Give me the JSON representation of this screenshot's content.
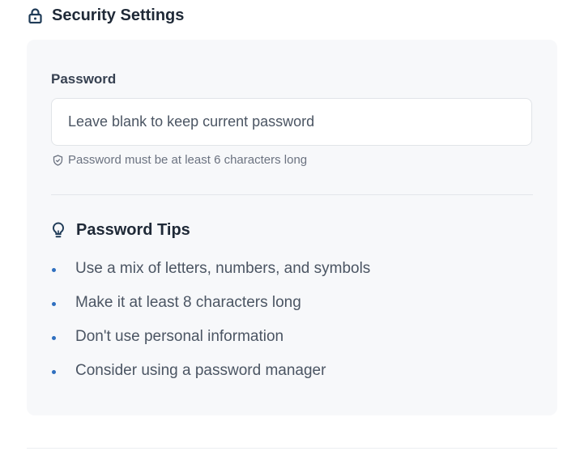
{
  "section": {
    "title": "Security Settings",
    "icon": "lock-icon"
  },
  "password_field": {
    "label": "Password",
    "value": "",
    "placeholder": "Leave blank to keep current password",
    "hint": "Password must be at least 6 characters long",
    "hint_icon": "shield-check-icon"
  },
  "tips": {
    "title": "Password Tips",
    "icon": "lightbulb-icon",
    "items": [
      "Use a mix of letters, numbers, and symbols",
      "Make it at least 8 characters long",
      "Don't use personal information",
      "Consider using a password manager"
    ]
  },
  "colors": {
    "accent": "#2f6fbf",
    "icon_dark": "#1f3b57",
    "card_background": "#f7f8fa"
  }
}
